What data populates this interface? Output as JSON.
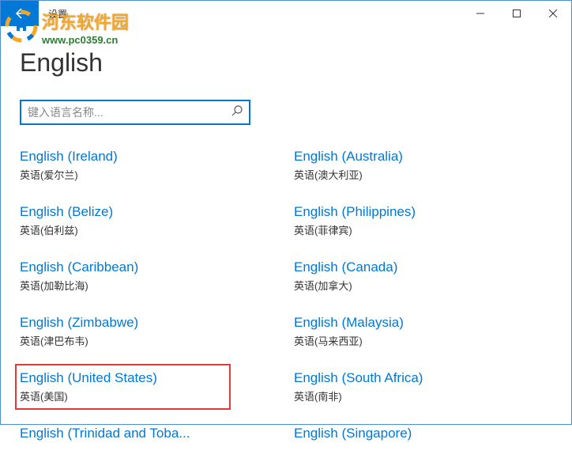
{
  "window": {
    "title": "设置"
  },
  "page": {
    "heading": "English"
  },
  "search": {
    "placeholder": "键入语言名称..."
  },
  "watermark": {
    "main": "河东软件园",
    "url": "www.pc0359.cn"
  },
  "languages": {
    "left": [
      {
        "name": "English (Ireland)",
        "native": "英语(爱尔兰)"
      },
      {
        "name": "English (Belize)",
        "native": "英语(伯利兹)"
      },
      {
        "name": "English (Caribbean)",
        "native": "英语(加勒比海)"
      },
      {
        "name": "English (Zimbabwe)",
        "native": "英语(津巴布韦)"
      },
      {
        "name": "English (United States)",
        "native": "英语(美国)",
        "highlighted": true
      },
      {
        "name": "English (Trinidad and Toba...",
        "native": ""
      }
    ],
    "right": [
      {
        "name": "English (Australia)",
        "native": "英语(澳大利亚)"
      },
      {
        "name": "English (Philippines)",
        "native": "英语(菲律宾)"
      },
      {
        "name": "English (Canada)",
        "native": "英语(加拿大)"
      },
      {
        "name": "English (Malaysia)",
        "native": "英语(马来西亚)"
      },
      {
        "name": "English (South Africa)",
        "native": "英语(南非)"
      },
      {
        "name": "English (Singapore)",
        "native": ""
      }
    ]
  }
}
